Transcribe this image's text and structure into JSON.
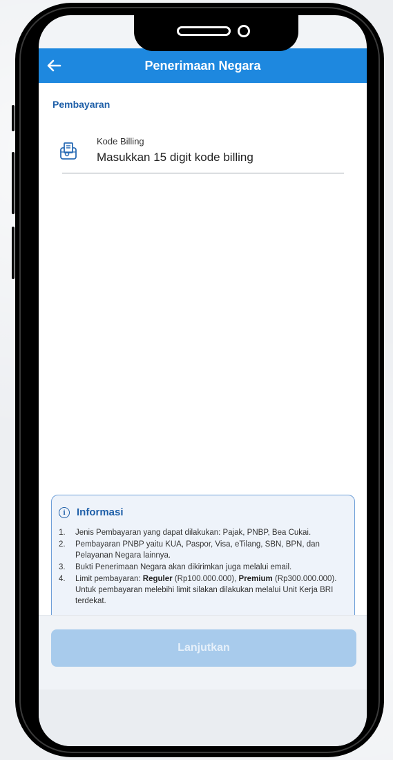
{
  "appbar": {
    "title": "Penerimaan Negara"
  },
  "section": {
    "title": "Pembayaran"
  },
  "billing_field": {
    "label": "Kode Billing",
    "placeholder": "Masukkan 15 digit kode billing",
    "value": ""
  },
  "info": {
    "title": "Informasi",
    "items": [
      {
        "num": "1.",
        "text": "Jenis Pembayaran yang dapat dilakukan: Pajak, PNBP, Bea Cukai."
      },
      {
        "num": "2.",
        "text": "Pembayaran PNBP yaitu KUA, Paspor, Visa, eTilang, SBN, BPN, dan Pelayanan Negara lainnya."
      },
      {
        "num": "3.",
        "text": "Bukti Penerimaan Negara akan dikirimkan juga melalui email."
      },
      {
        "num": "4.",
        "t1": "Limit pembayaran: ",
        "b1": "Reguler",
        "t2": " (Rp100.000.000), ",
        "b2": "Premium",
        "t3": " (Rp300.000.000). Untuk pembayaran melebihi limit silakan dilakukan melalui Unit Kerja BRI terdekat."
      }
    ]
  },
  "footer": {
    "button_label": "Lanjutkan",
    "button_enabled": false
  },
  "colors": {
    "primary": "#1e88df",
    "section_text": "#1e5fa8",
    "info_border": "#6e9fd8",
    "button_disabled": "#a8cbec"
  },
  "icons": {
    "back": "arrow-left-icon",
    "billing": "billing-receipt-icon",
    "info": "info-circle-icon"
  }
}
